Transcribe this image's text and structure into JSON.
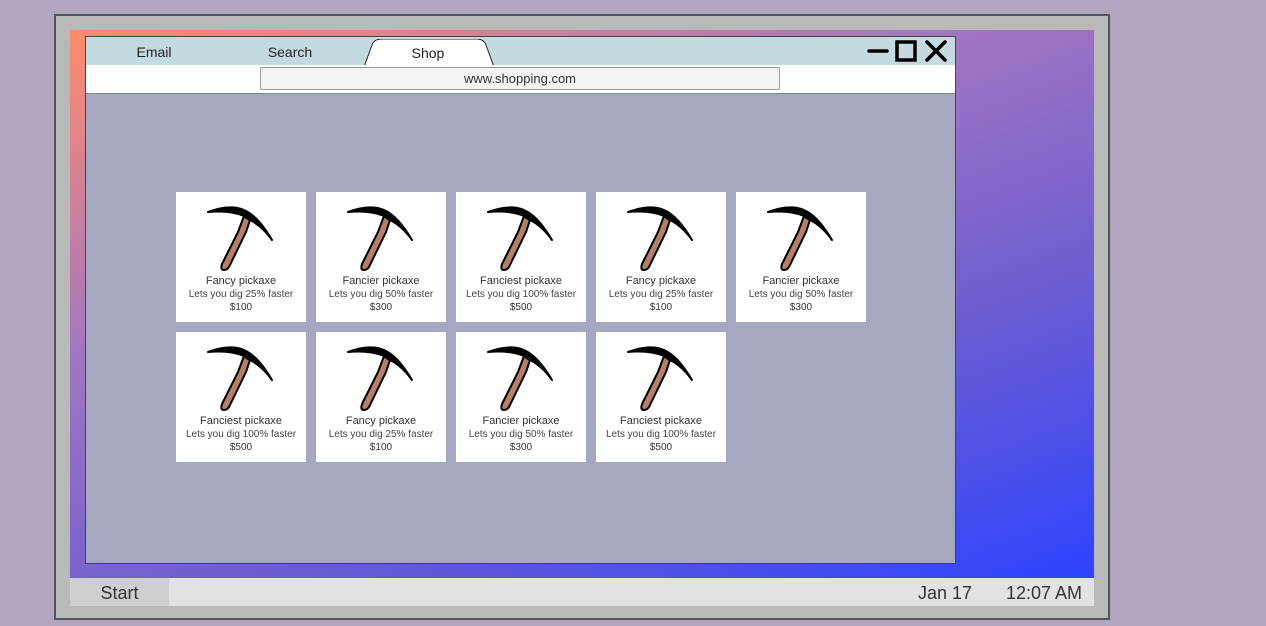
{
  "browser": {
    "tabs": [
      {
        "label": "Email"
      },
      {
        "label": "Search"
      },
      {
        "label": "Shop"
      }
    ],
    "url": "www.shopping.com",
    "controls": [
      "minimize-icon",
      "maximize-icon",
      "close-icon"
    ]
  },
  "products": [
    {
      "name": "Fancy pickaxe",
      "desc": "Lets you dig 25% faster",
      "price": "$100"
    },
    {
      "name": "Fancier pickaxe",
      "desc": "Lets you dig 50% faster",
      "price": "$300"
    },
    {
      "name": "Fanciest pickaxe",
      "desc": "Lets you dig 100% faster",
      "price": "$500"
    },
    {
      "name": "Fancy pickaxe",
      "desc": "Lets you dig 25% faster",
      "price": "$100"
    },
    {
      "name": "Fancier pickaxe",
      "desc": "Lets you dig 50% faster",
      "price": "$300"
    },
    {
      "name": "Fanciest pickaxe",
      "desc": "Lets you dig 100% faster",
      "price": "$500"
    },
    {
      "name": "Fancy pickaxe",
      "desc": "Lets you dig 25% faster",
      "price": "$100"
    },
    {
      "name": "Fancier pickaxe",
      "desc": "Lets you dig 50% faster",
      "price": "$300"
    },
    {
      "name": "Fanciest pickaxe",
      "desc": "Lets you dig 100% faster",
      "price": "$500"
    }
  ],
  "taskbar": {
    "start_label": "Start",
    "date": "Jan 17",
    "time": "12:07 AM"
  }
}
